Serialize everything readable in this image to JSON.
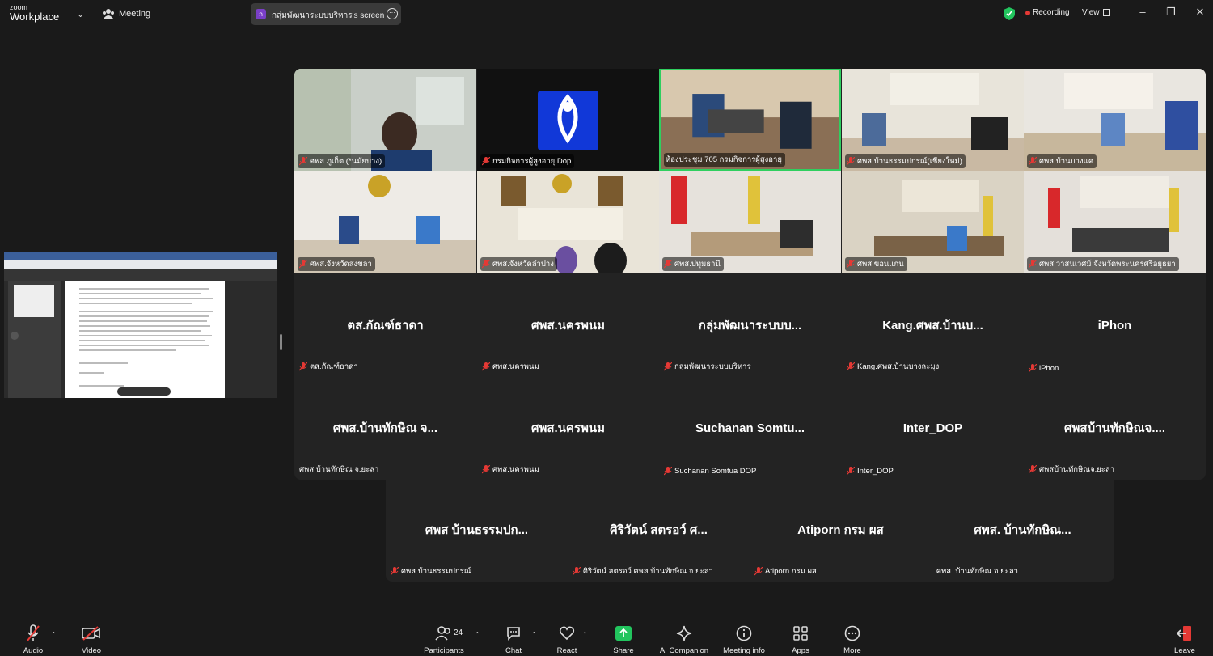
{
  "app": {
    "logo_line1": "zoom",
    "logo_line2": "Workplace",
    "meeting_label": "Meeting",
    "share_initial": "ก",
    "share_label": "กลุ่มพัฒนาระบบบริหาร's screen",
    "recording_label": "Recording",
    "view_label": "View"
  },
  "video_tiles": [
    {
      "name": "ศพส.ภูเก็ต (*นมัยบาง)"
    },
    {
      "name": "กรมกิจการผู้สูงอายุ Dop"
    },
    {
      "name": "ห้องประชุม 705 กรมกิจการผู้สูงอายุ"
    },
    {
      "name": "ศพส.บ้านธรรมปกรณ์(เชียงใหม่)"
    },
    {
      "name": "ศพส.บ้านบางแค"
    },
    {
      "name": "ศพส.จังหวัดสงขลา"
    },
    {
      "name": "ศพส.จังหวัดลำปาง"
    },
    {
      "name": "ศพส.ปทุมธานี"
    },
    {
      "name": "ศพส.ขอนแกน"
    },
    {
      "name": "ศพส.วาสนเวศม์ จังหวัดพระนครศรีอยุธยา"
    }
  ],
  "name_tiles_row3": [
    {
      "display": "ตส.กัณฑ์ธาดา",
      "name": "ตส.กัณฑ์ธาดา"
    },
    {
      "display": "ศพส.นครพนม",
      "name": "ศพส.นครพนม"
    },
    {
      "display": "กลุ่มพัฒนาระบบบ...",
      "name": "กลุ่มพัฒนาระบบบริหาร"
    },
    {
      "display": "Kang.ศพส.บ้านบ...",
      "name": "Kang.ศพส.บ้านบางละมุง"
    },
    {
      "display": "iPhon",
      "name": "iPhon"
    }
  ],
  "name_tiles_row4": [
    {
      "display": "ศพส.บ้านทักษิณ จ...",
      "name": "ศพส.บ้านทักษิณ จ.ยะลา"
    },
    {
      "display": "ศพส.นครพนม",
      "name": "ศพส.นครพนม"
    },
    {
      "display": "Suchanan  Somtu...",
      "name": "Suchanan Somtua DOP"
    },
    {
      "display": "Inter_DOP",
      "name": "Inter_DOP"
    },
    {
      "display": "ศพสบ้านทักษิณจ....",
      "name": "ศพสบ้านทักษิณจ.ยะลา"
    }
  ],
  "name_tiles_row5": [
    {
      "display": "ศพส บ้านธรรมปก...",
      "name": "ศพส บ้านธรรมปกรณ์"
    },
    {
      "display": "ศิริวัตน์ สตรอว์ ศ...",
      "name": "ศิริวัตน์ สตรอว์ ศพส.บ้านทักษิณ จ.ยะลา"
    },
    {
      "display": "Atiporn กรม ผส",
      "name": "Atiporn กรม ผส"
    },
    {
      "display": "ศพส. บ้านทักษิณ...",
      "name": "ศพส. บ้านทักษิณ จ.ยะลา"
    }
  ],
  "toolbar": {
    "audio": "Audio",
    "video": "Video",
    "participants": "Participants",
    "participant_count": "24",
    "chat": "Chat",
    "react": "React",
    "share": "Share",
    "ai_companion": "AI Companion",
    "meeting_info": "Meeting info",
    "apps": "Apps",
    "more": "More",
    "leave": "Leave"
  },
  "colors": {
    "background": "#1a1a1a",
    "tile_bg": "#232323",
    "active_speaker": "#2fcf5f",
    "recording": "#e53935",
    "share_green": "#22c55e",
    "mic_muted": "#e53935"
  }
}
